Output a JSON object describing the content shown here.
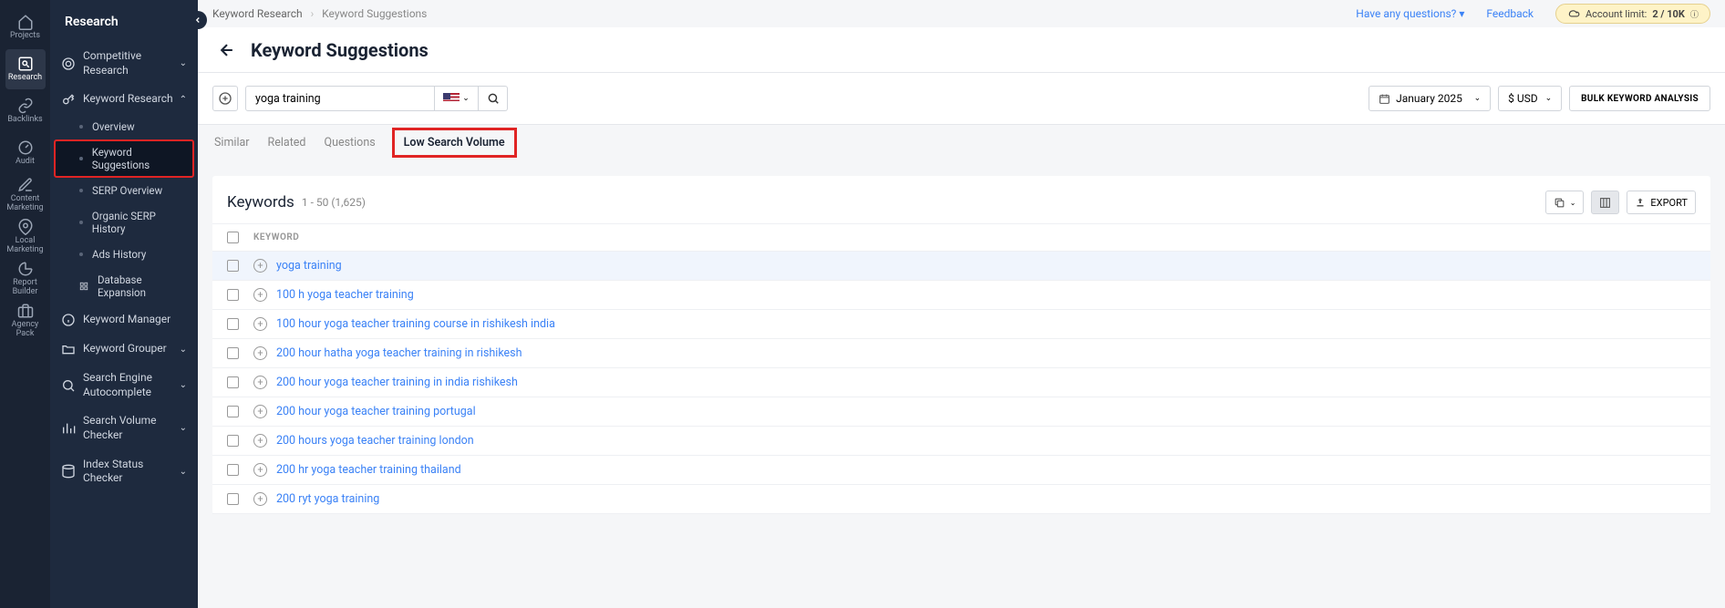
{
  "iconNav": {
    "projects": "Projects",
    "research": "Research",
    "backlinks": "Backlinks",
    "audit": "Audit",
    "content": "Content\nMarketing",
    "local": "Local\nMarketing",
    "report": "Report\nBuilder",
    "agency": "Agency\nPack"
  },
  "sidebar": {
    "header": "Research",
    "competitive": "Competitive Research",
    "keywordResearch": "Keyword Research",
    "sub": {
      "overview": "Overview",
      "suggestions": "Keyword Suggestions",
      "serpOverview": "SERP Overview",
      "organicHistory": "Organic SERP History",
      "adsHistory": "Ads History",
      "dbExpansion": "Database Expansion"
    },
    "keywordManager": "Keyword Manager",
    "keywordGrouper": "Keyword Grouper",
    "autocomplete": "Search Engine Autocomplete",
    "volumeChecker": "Search Volume Checker",
    "indexStatus": "Index Status Checker"
  },
  "breadcrumb": {
    "root": "Keyword Research",
    "current": "Keyword Suggestions"
  },
  "topbar": {
    "questions": "Have any questions?",
    "feedback": "Feedback",
    "accountLabel": "Account limit:",
    "accountValue": "2 / 10K"
  },
  "pageTitle": "Keyword Suggestions",
  "search": {
    "value": "yoga training",
    "date": "January 2025",
    "currency": "$ USD",
    "bulk": "BULK KEYWORD ANALYSIS"
  },
  "tabs": {
    "similar": "Similar",
    "related": "Related",
    "questions": "Questions",
    "low": "Low Search Volume"
  },
  "table": {
    "title": "Keywords",
    "range": "1 - 50 (1,625)",
    "export": "EXPORT",
    "headerKeyword": "KEYWORD",
    "rows": [
      "yoga training",
      "100 h yoga teacher training",
      "100 hour yoga teacher training course in rishikesh india",
      "200 hour hatha yoga teacher training in rishikesh",
      "200 hour yoga teacher training in india rishikesh",
      "200 hour yoga teacher training portugal",
      "200 hours yoga teacher training london",
      "200 hr yoga teacher training thailand",
      "200 ryt yoga training"
    ]
  }
}
